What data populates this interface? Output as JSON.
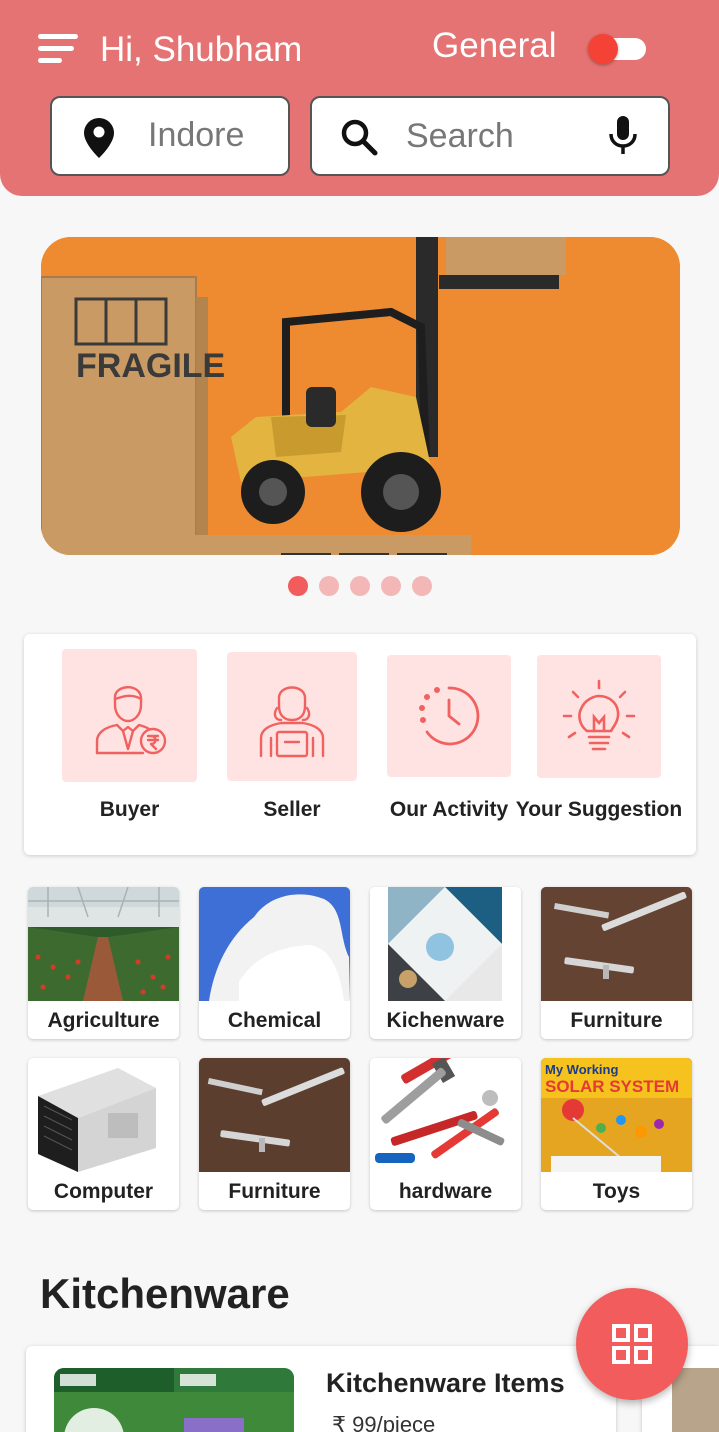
{
  "header": {
    "greeting": "Hi, Shubham",
    "mode_label": "General",
    "toggle_on": true,
    "location": "Indore",
    "search_placeholder": "Search"
  },
  "carousel": {
    "slides": 5,
    "active_index": 0,
    "banner_text": "FRAGILE"
  },
  "roles": [
    {
      "label": "Buyer",
      "icon": "buyer-icon"
    },
    {
      "label": "Seller",
      "icon": "seller-icon"
    },
    {
      "label": "Our Activity",
      "icon": "activity-clock-icon"
    },
    {
      "label": "Your Suggestion",
      "icon": "lightbulb-icon"
    }
  ],
  "categories": [
    {
      "label": "Agriculture"
    },
    {
      "label": "Chemical"
    },
    {
      "label": "Kichenware"
    },
    {
      "label": "Furniture"
    },
    {
      "label": "Computer"
    },
    {
      "label": "Furniture"
    },
    {
      "label": "hardware"
    },
    {
      "label": "Toys"
    }
  ],
  "section": {
    "title": "Kitchenware"
  },
  "products": [
    {
      "name": "Kitchenware Items",
      "price": "₹ 99/piece"
    }
  ],
  "colors": {
    "header": "#e57373",
    "accent": "#f25c5c",
    "tile_bg": "#ffe3e3"
  }
}
